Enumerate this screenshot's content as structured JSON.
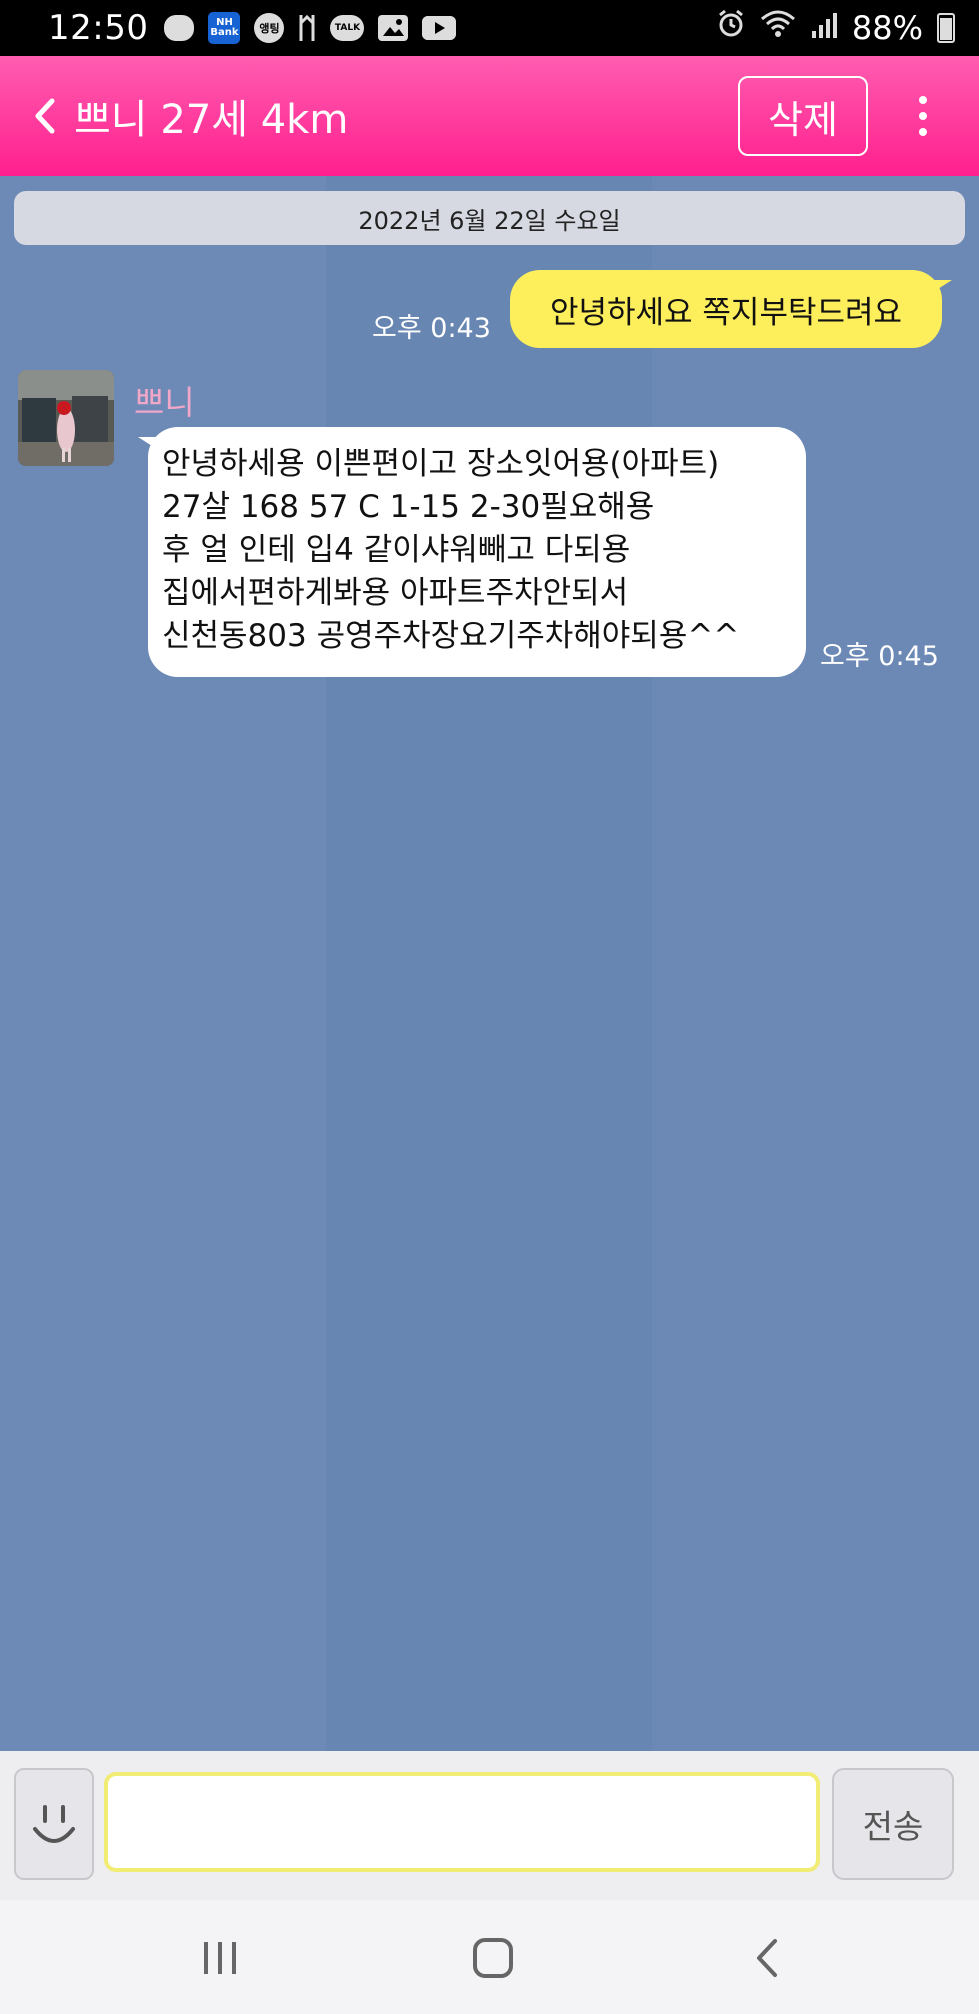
{
  "status_bar": {
    "time": "12:50",
    "left_icons": [
      "message-icon",
      "nh-bank-icon",
      "app-icon",
      "signal-app-icon",
      "talk-icon",
      "gallery-icon",
      "youtube-icon"
    ],
    "nh_bank_label": "NH Bank",
    "talk_label": "TALK",
    "app_label": "앵팅",
    "battery": "88%"
  },
  "header": {
    "title": "쁘니 27세 4km",
    "delete_label": "삭제",
    "accent": "#ff3ea0"
  },
  "chat": {
    "date": "2022년 6월 22일 수요일",
    "messages": [
      {
        "direction": "outgoing",
        "time": "오후 0:43",
        "text": "안녕하세요 쪽지부탁드려요"
      },
      {
        "direction": "incoming",
        "sender": "쁘니",
        "time": "오후 0:45",
        "lines": [
          "안녕하세용 이쁜편이고 장소잇어용(아파트)",
          "27살 168 57 C 1-15 2-30필요해용",
          "후 얼 인테 입4 같이샤워빼고 다되용",
          "집에서편하게봐용 아파트주차안되서",
          "신천동803 공영주차장요기주차해야되용^^"
        ]
      }
    ]
  },
  "input": {
    "value": "",
    "send_label": "전송"
  },
  "colors": {
    "chat_background": "#6d89b6",
    "outgoing_bubble": "#fdee5c",
    "incoming_bubble": "#ffffff",
    "sender_name": "#f0a7c8"
  }
}
